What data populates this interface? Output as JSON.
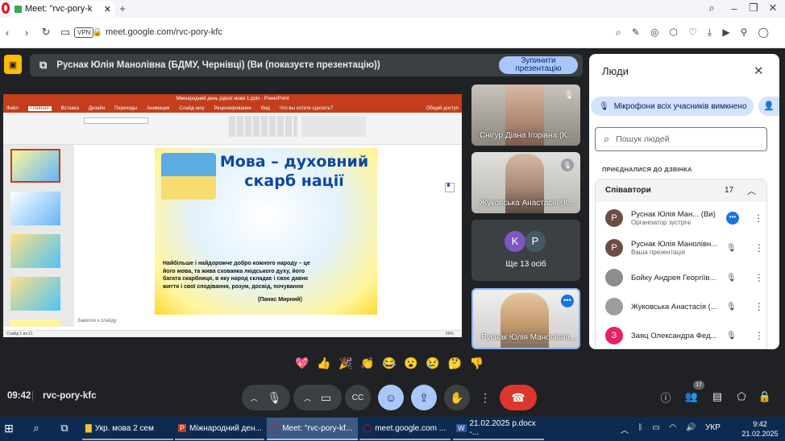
{
  "browser": {
    "tab_title": "Meet: \"rvc-pory-k",
    "vpn": "VPN",
    "url": "meet.google.com/rvc-pory-kfc"
  },
  "banner": {
    "text": "Руснак Юлія Манолівна (БДМУ, Чернівці) (Ви (показуєте презентацію))",
    "stop": "Зупинити презентацію"
  },
  "ppt": {
    "title": "Міжнародний день рідної мови 1.pptx - PowerPoint",
    "menu": [
      "Файл",
      "Главная",
      "Вставка",
      "Дизайн",
      "Переходы",
      "Анимация",
      "Слайд-шоу",
      "Рецензирование",
      "Вид"
    ],
    "search": "Что вы хотите сделать?",
    "share": "Общий доступ",
    "slide_title": "Мова – духовний скарб нації",
    "slide_body": "Найбільше і найдорожче добро кожного народу – це його мова, та жива схованка людського духу, його багата скарбниця, в яку народ складає і своє давнє життя і свої сподівання, розум, досвід, почування",
    "slide_author": "(Панас Мирний)",
    "notes": "Заметки к слайду",
    "status": "Слайд 1 из 21",
    "zoom": "69%"
  },
  "tiles": [
    {
      "name": "Снігур Діана Ігорівна (К..."
    },
    {
      "name": "Жуковська Анастасія (К..."
    },
    {
      "name": "Ще 13 осіб",
      "k": "K",
      "p": "P"
    },
    {
      "name": "Руснак Юлія Манолівна..."
    }
  ],
  "people": {
    "title": "Люди",
    "mute_all": "Мікрофони всіх учасників вимкнено",
    "search_placeholder": "Пошук людей",
    "joined": "ПРИЄДНАЛИСЯ ДО ДЗВІНКА",
    "group": "Співавтори",
    "count": "17",
    "rows": [
      {
        "initial": "Р",
        "name": "Руснак Юлія Ман...",
        "you": "(Ви)",
        "sub": "Організатор зустрічі",
        "color": "#6d4c41"
      },
      {
        "initial": "Р",
        "name": "Руснак Юлія Манолівн...",
        "you": "",
        "sub": "Ваша презентація",
        "color": "#6d4c41"
      },
      {
        "initial": "",
        "name": "Бойку Андрея Георгіїв...",
        "you": "",
        "sub": "",
        "color": "#8d8d8d"
      },
      {
        "initial": "",
        "name": "Жуковська Анастасія (...",
        "you": "",
        "sub": "",
        "color": "#9e9e9e"
      },
      {
        "initial": "З",
        "name": "Заяц Олександра Фед...",
        "you": "",
        "sub": "",
        "color": "#e91e63"
      }
    ]
  },
  "reactions": [
    "💖",
    "👍",
    "🎉",
    "👏",
    "😂",
    "😮",
    "😢",
    "🤔",
    "👎"
  ],
  "bottom": {
    "time": "09:42",
    "code": "rvc-pory-kfc",
    "badge": "17"
  },
  "taskbar": {
    "items": [
      "Укр. мова 2 сем",
      "Міжнародний ден...",
      "Meet: \"rvc-pory-kf...",
      "meet.google.com ...",
      "21.02.2025 р.docx -..."
    ],
    "lang": "УКР",
    "clock": "9:42",
    "date": "21.02.2025"
  }
}
